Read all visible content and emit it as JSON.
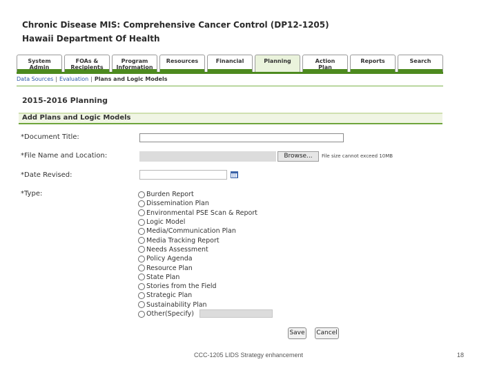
{
  "header": {
    "app_title": "Chronic Disease MIS: Comprehensive Cancer Control (DP12-1205)",
    "org_title": "Hawaii Department Of Health"
  },
  "tabs": [
    {
      "label": "System\nAdmin"
    },
    {
      "label": "FOAs &\nRecipients"
    },
    {
      "label": "Program\nInformation"
    },
    {
      "label": "Resources"
    },
    {
      "label": "Financial"
    },
    {
      "label": "Planning",
      "active": true
    },
    {
      "label": "Action\nPlan"
    },
    {
      "label": "Reports"
    },
    {
      "label": "Search"
    }
  ],
  "subnav": {
    "data_sources": "Data Sources",
    "evaluation": "Evaluation",
    "current": "Plans and Logic Models",
    "separator": "|"
  },
  "page": {
    "planning_title": "2015-2016 Planning",
    "section_title": "Add Plans and Logic Models"
  },
  "form": {
    "document_title_label": "*Document Title:",
    "document_title_value": "",
    "file_label": "*File Name and Location:",
    "file_value": "",
    "browse_label": "Browse...",
    "file_note": "File size cannot exceed 10MB",
    "date_label": "*Date Revised:",
    "date_value": "",
    "type_label": "*Type:",
    "type_options": [
      "Burden Report",
      "Dissemination Plan",
      "Environmental PSE Scan & Report",
      "Logic Model",
      "Media/Communication Plan",
      "Media Tracking Report",
      "Needs Assessment",
      "Policy Agenda",
      "Resource Plan",
      "State Plan",
      "Stories from the Field",
      "Strategic Plan",
      "Sustainability Plan",
      "Other(Specify)"
    ],
    "other_value": "",
    "save_label": "Save",
    "cancel_label": "Cancel"
  },
  "footer": {
    "text": "CCC-1205 LIDS Strategy enhancement",
    "page_number": "18"
  },
  "colors": {
    "accent_green": "#4d8a1f",
    "link_blue": "#2a56a8"
  },
  "icons": {
    "calendar": "calendar-icon"
  }
}
